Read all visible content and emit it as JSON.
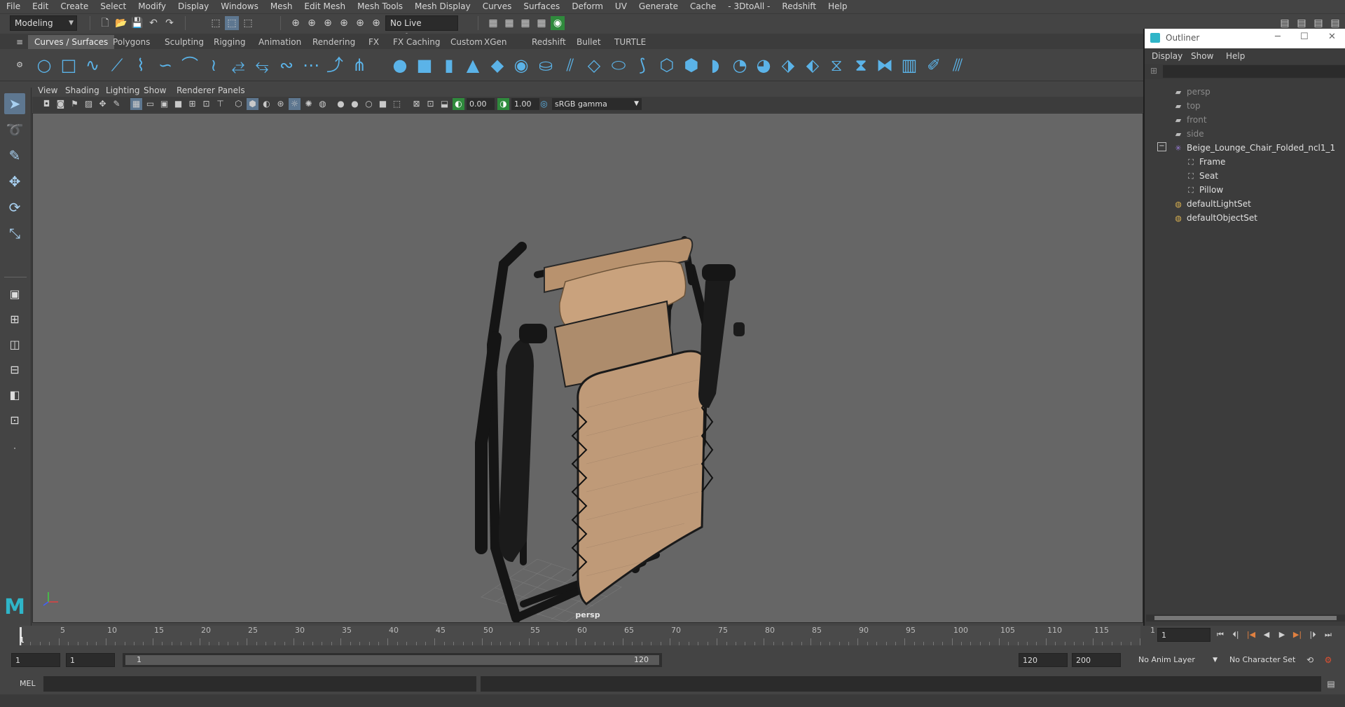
{
  "menu": [
    "File",
    "Edit",
    "Create",
    "Select",
    "Modify",
    "Display",
    "Windows",
    "Mesh",
    "Edit Mesh",
    "Mesh Tools",
    "Mesh Display",
    "Curves",
    "Surfaces",
    "Deform",
    "UV",
    "Generate",
    "Cache",
    "- 3DtoAll -",
    "Redshift",
    "Help"
  ],
  "status": {
    "mode_select": "Modeling",
    "live_surface": "No Live Surface"
  },
  "shelf_tabs": [
    "Curves / Surfaces",
    "Polygons",
    "Sculpting",
    "Rigging",
    "Animation",
    "Rendering",
    "FX",
    "FX Caching",
    "Custom",
    "XGen",
    "Redshift",
    "Bullet",
    "TURTLE"
  ],
  "panel_menu": [
    "View",
    "Shading",
    "Lighting",
    "Show",
    "Renderer",
    "Panels"
  ],
  "panel_toolbar": {
    "exposure": "0.00",
    "gamma": "1.00",
    "color_space": "sRGB gamma"
  },
  "viewport": {
    "camera_label": "persp"
  },
  "outliner": {
    "title": "Outliner",
    "menu": [
      "Display",
      "Show",
      "Help"
    ],
    "items": [
      {
        "label": "persp",
        "icon": "camera-icon",
        "indent": 0,
        "dim": true
      },
      {
        "label": "top",
        "icon": "camera-icon",
        "indent": 0,
        "dim": true
      },
      {
        "label": "front",
        "icon": "camera-icon",
        "indent": 0,
        "dim": true
      },
      {
        "label": "side",
        "icon": "camera-icon",
        "indent": 0,
        "dim": true
      },
      {
        "label": "Beige_Lounge_Chair_Folded_ncl1_1",
        "icon": "group-icon",
        "indent": 0,
        "dim": false
      },
      {
        "label": "Frame",
        "icon": "mesh-icon",
        "indent": 1,
        "dim": false
      },
      {
        "label": "Seat",
        "icon": "mesh-icon",
        "indent": 1,
        "dim": false
      },
      {
        "label": "Pillow",
        "icon": "mesh-icon",
        "indent": 1,
        "dim": false
      },
      {
        "label": "defaultLightSet",
        "icon": "set-icon",
        "indent": 0,
        "dim": false
      },
      {
        "label": "defaultObjectSet",
        "icon": "set-icon",
        "indent": 0,
        "dim": false
      }
    ]
  },
  "timeline": {
    "ticks": [
      "5",
      "10",
      "15",
      "20",
      "25",
      "30",
      "35",
      "40",
      "45",
      "50",
      "55",
      "60",
      "65",
      "70",
      "75",
      "80",
      "85",
      "90",
      "95",
      "100",
      "105",
      "110",
      "115",
      "1"
    ],
    "current_frame": "1",
    "start_frame": "1"
  },
  "range": {
    "anim_start": "1",
    "playback_start": "1",
    "slider_start": "1",
    "slider_end": "120",
    "playback_end": "120",
    "anim_end": "200",
    "anim_layer": "No Anim Layer",
    "character_set": "No Character Set"
  },
  "command_line": {
    "label": "MEL"
  },
  "colors": {
    "accent": "#5bb3e8",
    "chair_fabric": "#c9a27d",
    "chair_frame": "#1a1a1a"
  }
}
